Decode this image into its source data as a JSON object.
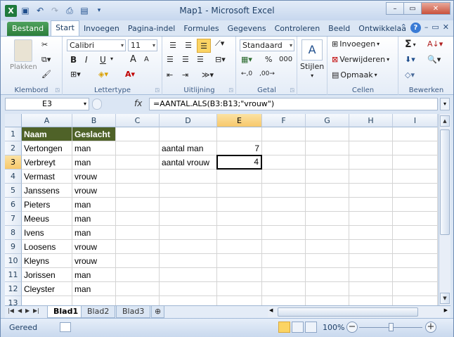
{
  "window": {
    "title": "Map1 - Microsoft Excel",
    "min": "–",
    "max": "▭",
    "close": "✕"
  },
  "tabs": [
    "Start",
    "Invoegen",
    "Pagina-indel",
    "Formules",
    "Gegevens",
    "Controleren",
    "Beeld",
    "Ontwikkelaa"
  ],
  "file_tab": "Bestand",
  "ribbon": {
    "clipboard": {
      "label": "Klembord",
      "paste": "Plakken"
    },
    "font": {
      "label": "Lettertype",
      "name": "Calibri",
      "size": "11",
      "bold": "B",
      "italic": "I",
      "underline": "U",
      "grow": "A",
      "shrink": "A"
    },
    "alignment": {
      "label": "Uitlijning"
    },
    "number": {
      "label": "Getal",
      "format": "Standaard",
      "percent": "%",
      "thousands": "000"
    },
    "styles": {
      "label": "Stijlen"
    },
    "cells": {
      "label": "Cellen",
      "insert": "Invoegen",
      "delete": "Verwijderen",
      "format": "Opmaak"
    },
    "editing": {
      "label": "Bewerken",
      "sum": "Σ"
    }
  },
  "formula_bar": {
    "name_box": "E3",
    "fx": "fx",
    "formula": "=AANTAL.ALS(B3:B13;\"vrouw\")"
  },
  "columns": [
    "A",
    "B",
    "C",
    "D",
    "E",
    "F",
    "G",
    "H",
    "I"
  ],
  "rows": [
    "1",
    "2",
    "3",
    "4",
    "5",
    "6",
    "7",
    "8",
    "9",
    "10",
    "11",
    "12",
    "13"
  ],
  "cells": {
    "A1": "Naam",
    "B1": "Geslacht",
    "A2": "Vertongen",
    "B2": "man",
    "A3": "Verbreyt",
    "B3": "man",
    "A4": "Vermast",
    "B4": "vrouw",
    "A5": "Janssens",
    "B5": "vrouw",
    "A6": "Pieters",
    "B6": "man",
    "A7": "Meeus",
    "B7": "man",
    "A8": "Ivens",
    "B8": "man",
    "A9": "Loosens",
    "B9": "vrouw",
    "A10": "Kleyns",
    "B10": "vrouw",
    "A11": "Jorissen",
    "B11": "man",
    "A12": "Cleyster",
    "B12": "man",
    "D2": "aantal man",
    "E2": "7",
    "D3": "aantal vrouw",
    "E3": "4"
  },
  "sheets": [
    "Blad1",
    "Blad2",
    "Blad3"
  ],
  "status": {
    "ready": "Gereed",
    "zoom": "100%"
  },
  "colors": {
    "header_fill": "#4f6228",
    "header_text": "#ffffff",
    "selection": "#f7c86b"
  }
}
